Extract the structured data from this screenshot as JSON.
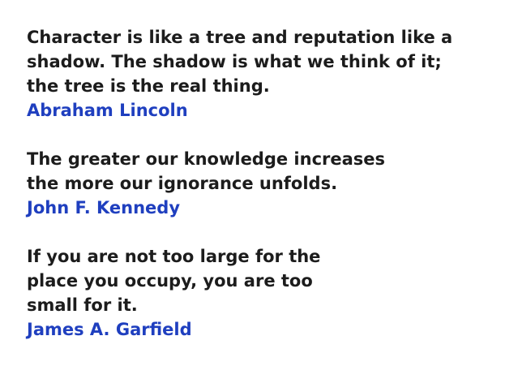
{
  "quotes": [
    {
      "lines": [
        "Character is like a tree and reputation like a",
        "shadow. The shadow is what we think of it;",
        "the tree is the real thing."
      ],
      "author": "Abraham Lincoln"
    },
    {
      "lines": [
        "The greater our knowledge increases",
        "the more our ignorance unfolds."
      ],
      "author": "John F. Kennedy"
    },
    {
      "lines": [
        "If you are not too large for the",
        "place you occupy, you are too",
        "small for it."
      ],
      "author": "James A. Garfield"
    }
  ],
  "colors": {
    "quote_text": "#1c1c1c",
    "author_text": "#1f3fbf",
    "background": "#ffffff"
  }
}
